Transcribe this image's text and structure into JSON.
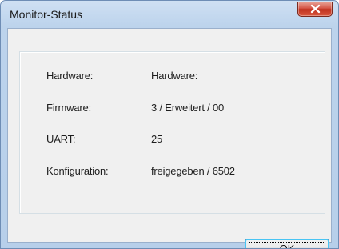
{
  "window": {
    "title": "Monitor-Status"
  },
  "info": {
    "rows": [
      {
        "label": "Hardware:",
        "value": "Hardware:"
      },
      {
        "label": "Firmware:",
        "value": "3 / Erweitert / 00"
      },
      {
        "label": "UART:",
        "value": "25"
      },
      {
        "label": "Konfiguration:",
        "value": "freigegeben / 6502"
      }
    ]
  },
  "buttons": {
    "ok_label": "OK"
  },
  "colors": {
    "title_bar": "#bcd3ec",
    "close_button": "#c0311f",
    "dialog_background": "#f0f0f0"
  }
}
